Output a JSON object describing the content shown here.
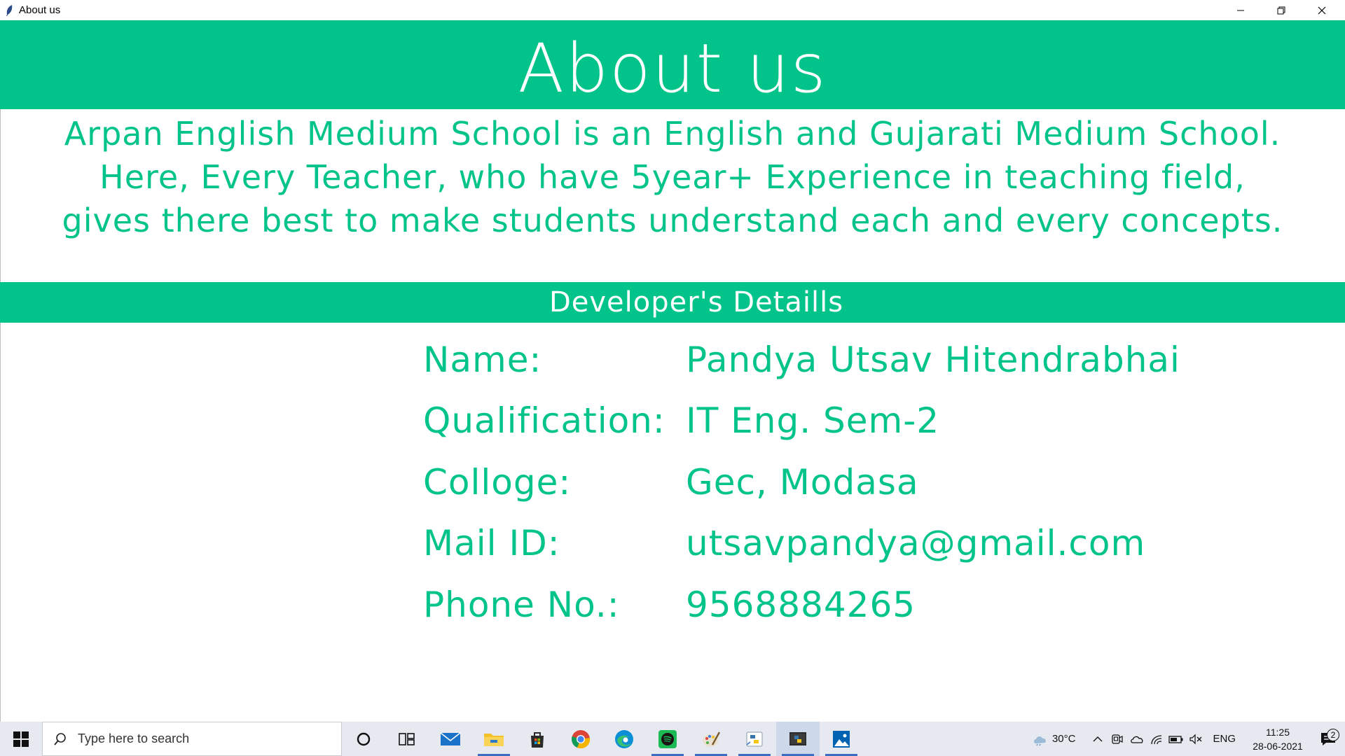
{
  "window": {
    "title": "About us",
    "controls": [
      "minimize",
      "restore",
      "close"
    ]
  },
  "header": {
    "heading": "About us"
  },
  "description": {
    "lines": [
      "Arpan English Medium School is an English and Gujarati Medium School.",
      "Here, Every Teacher, who have 5year+ Experience in teaching field,",
      "gives there best to make students understand each and every concepts."
    ]
  },
  "developer": {
    "section_title": "Developer's Detaills",
    "rows": [
      {
        "label": "Name:",
        "value": "Pandya Utsav Hitendrabhai"
      },
      {
        "label": "Qualification:",
        "value": "IT Eng. Sem-2"
      },
      {
        "label": "Colloge:",
        "value": "Gec, Modasa"
      },
      {
        "label": "Mail ID:",
        "value": "utsavpandya@gmail.com"
      },
      {
        "label": "Phone No.:",
        "value": "9568884265"
      }
    ]
  },
  "taskbar": {
    "search_placeholder": "Type here to search",
    "apps": [
      "cortana",
      "task-view",
      "mail",
      "file-explorer",
      "store",
      "chrome",
      "edge",
      "spotify",
      "paint",
      "python-idle",
      "python-app",
      "photos"
    ],
    "weather": "30°C",
    "language": "ENG",
    "time": "11:25",
    "date": "28-06-2021",
    "notification_count": "2"
  },
  "colors": {
    "accent": "#02c48a",
    "text_on_accent": "#ffffff"
  }
}
